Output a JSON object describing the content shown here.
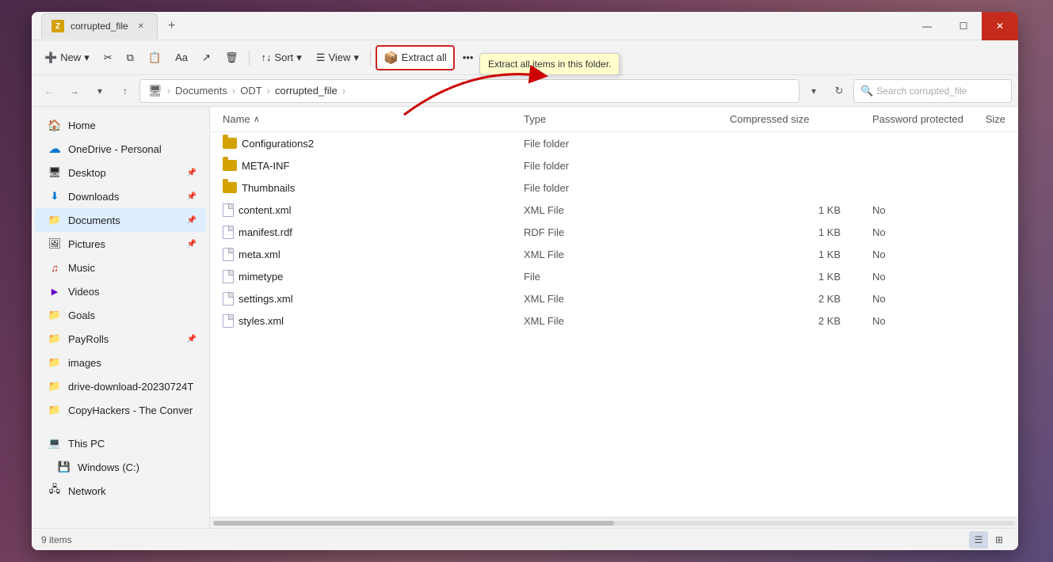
{
  "window": {
    "title": "corrupted_file",
    "tab_label": "corrupted_file",
    "new_tab_label": "+",
    "min_label": "—",
    "max_label": "☐",
    "close_label": "✕"
  },
  "toolbar": {
    "new_label": "New",
    "new_dropdown": "▾",
    "cut_icon": "✂",
    "copy_icon": "⧉",
    "paste_icon": "📋",
    "rename_icon": "Aa",
    "share_icon": "↗",
    "delete_icon": "🗑",
    "sort_label": "Sort",
    "sort_dropdown": "▾",
    "view_label": "View",
    "view_dropdown": "▾",
    "extract_label": "Extract all",
    "more_label": "•••"
  },
  "tooltip": {
    "text": "Extract all items in this folder."
  },
  "address_bar": {
    "back_label": "←",
    "forward_label": "→",
    "dropdown_label": "▾",
    "up_label": "↑",
    "crumbs": [
      "Documents",
      "ODT",
      "corrupted_file"
    ],
    "search_placeholder": "Search corrupted_file",
    "search_icon": "🔍",
    "refresh_label": "↻"
  },
  "sidebar": {
    "home_label": "Home",
    "onedrive_label": "OneDrive - Personal",
    "items": [
      {
        "id": "desktop",
        "label": "Desktop",
        "pinned": true
      },
      {
        "id": "downloads",
        "label": "Downloads",
        "pinned": true
      },
      {
        "id": "documents",
        "label": "Documents",
        "pinned": true,
        "active": true
      },
      {
        "id": "pictures",
        "label": "Pictures",
        "pinned": true
      },
      {
        "id": "music",
        "label": "Music",
        "pinned": false
      },
      {
        "id": "videos",
        "label": "Videos",
        "pinned": false
      },
      {
        "id": "goals",
        "label": "Goals",
        "pinned": false
      },
      {
        "id": "payrolls",
        "label": "PayRolls",
        "pinned": true
      },
      {
        "id": "images",
        "label": "images",
        "pinned": false
      },
      {
        "id": "drive-download",
        "label": "drive-download-20230724T",
        "pinned": false
      },
      {
        "id": "copyhackers",
        "label": "CopyHackers - The Conver",
        "pinned": false
      }
    ],
    "this_pc_label": "This PC",
    "windows_c_label": "Windows (C:)",
    "network_label": "Network"
  },
  "file_list": {
    "col_name": "Name",
    "col_type": "Type",
    "col_compressed": "Compressed size",
    "col_password": "Password protected",
    "col_size": "Size",
    "sort_arrow": "∧",
    "files": [
      {
        "name": "Configurations2",
        "type": "File folder",
        "compressed": "",
        "password": "",
        "size": "",
        "is_folder": true
      },
      {
        "name": "META-INF",
        "type": "File folder",
        "compressed": "",
        "password": "",
        "size": "",
        "is_folder": true
      },
      {
        "name": "Thumbnails",
        "type": "File folder",
        "compressed": "",
        "password": "",
        "size": "",
        "is_folder": true
      },
      {
        "name": "content.xml",
        "type": "XML File",
        "compressed": "1 KB",
        "password": "No",
        "size": "",
        "is_folder": false
      },
      {
        "name": "manifest.rdf",
        "type": "RDF File",
        "compressed": "1 KB",
        "password": "No",
        "size": "",
        "is_folder": false
      },
      {
        "name": "meta.xml",
        "type": "XML File",
        "compressed": "1 KB",
        "password": "No",
        "size": "",
        "is_folder": false
      },
      {
        "name": "mimetype",
        "type": "File",
        "compressed": "1 KB",
        "password": "No",
        "size": "",
        "is_folder": false
      },
      {
        "name": "settings.xml",
        "type": "XML File",
        "compressed": "2 KB",
        "password": "No",
        "size": "",
        "is_folder": false
      },
      {
        "name": "styles.xml",
        "type": "XML File",
        "compressed": "2 KB",
        "password": "No",
        "size": "",
        "is_folder": false
      }
    ]
  },
  "status_bar": {
    "count_label": "9 items",
    "list_view_icon": "☰",
    "grid_view_icon": "⊞"
  }
}
